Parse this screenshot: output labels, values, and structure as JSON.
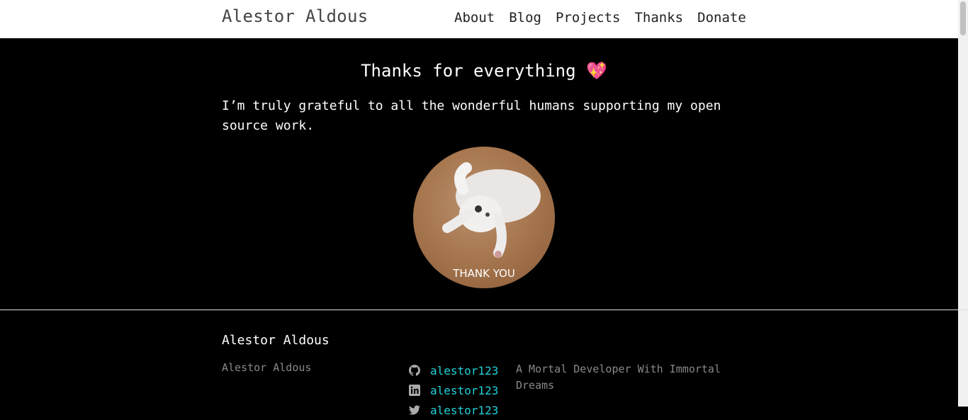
{
  "header": {
    "site_title": "Alestor Aldous",
    "nav": [
      {
        "label": "About"
      },
      {
        "label": "Blog"
      },
      {
        "label": "Projects"
      },
      {
        "label": "Thanks"
      },
      {
        "label": "Donate"
      }
    ]
  },
  "main": {
    "title": "Thanks for everything",
    "title_emoji": "💖",
    "intro": "I’m truly grateful to all the wonderful humans supporting my open source work.",
    "image_caption": "THANK YOU"
  },
  "footer": {
    "title": "Alestor Aldous",
    "name": "Alestor Aldous",
    "social": [
      {
        "icon": "github-icon",
        "handle": "alestor123"
      },
      {
        "icon": "linkedin-icon",
        "handle": "alestor123"
      },
      {
        "icon": "twitter-icon",
        "handle": "alestor123"
      }
    ],
    "tagline": "A Mortal Developer With Immortal Dreams"
  },
  "colors": {
    "background": "#000000",
    "header_bg": "#ffffff",
    "link": "#1fd1d9",
    "muted": "#888888"
  }
}
